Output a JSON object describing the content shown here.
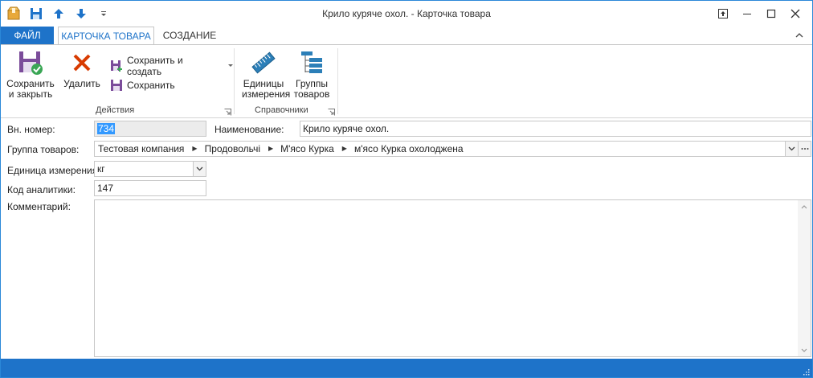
{
  "window": {
    "title": "Крило куряче охол. - Карточка товара"
  },
  "quick_access": {
    "icons": [
      "app-package-icon",
      "save-icon",
      "arrow-up-icon",
      "arrow-down-icon",
      "customize-icon"
    ]
  },
  "tabs": {
    "file": "ФАЙЛ",
    "card": "КАРТОЧКА ТОВАРА",
    "create": "СОЗДАНИЕ"
  },
  "ribbon": {
    "actions": {
      "label": "Действия",
      "save_close": "Сохранить и закрыть",
      "delete": "Удалить",
      "save_create": "Сохранить и создать",
      "save": "Сохранить"
    },
    "refs": {
      "label": "Справочники",
      "units": "Единицы измерения",
      "groups": "Группы товаров"
    }
  },
  "form": {
    "internal_number": {
      "label": "Вн. номер:",
      "value": "734"
    },
    "name": {
      "label": "Наименование:",
      "value": "Крило куряче охол."
    },
    "group": {
      "label": "Группа товаров:",
      "path": [
        "Тестовая компания",
        "Продовольчі",
        "М'ясо Курка",
        "м'ясо Курка охолоджена"
      ]
    },
    "unit": {
      "label": "Единица измерения:",
      "value": "кг"
    },
    "analytics_code": {
      "label": "Код аналитики:",
      "value": "147"
    },
    "comment": {
      "label": "Комментарий:",
      "value": ""
    }
  },
  "colors": {
    "accent": "#1e73c9",
    "selection": "#3399ff",
    "delete_red": "#d83b01",
    "save_purple": "#7b4c9a"
  }
}
